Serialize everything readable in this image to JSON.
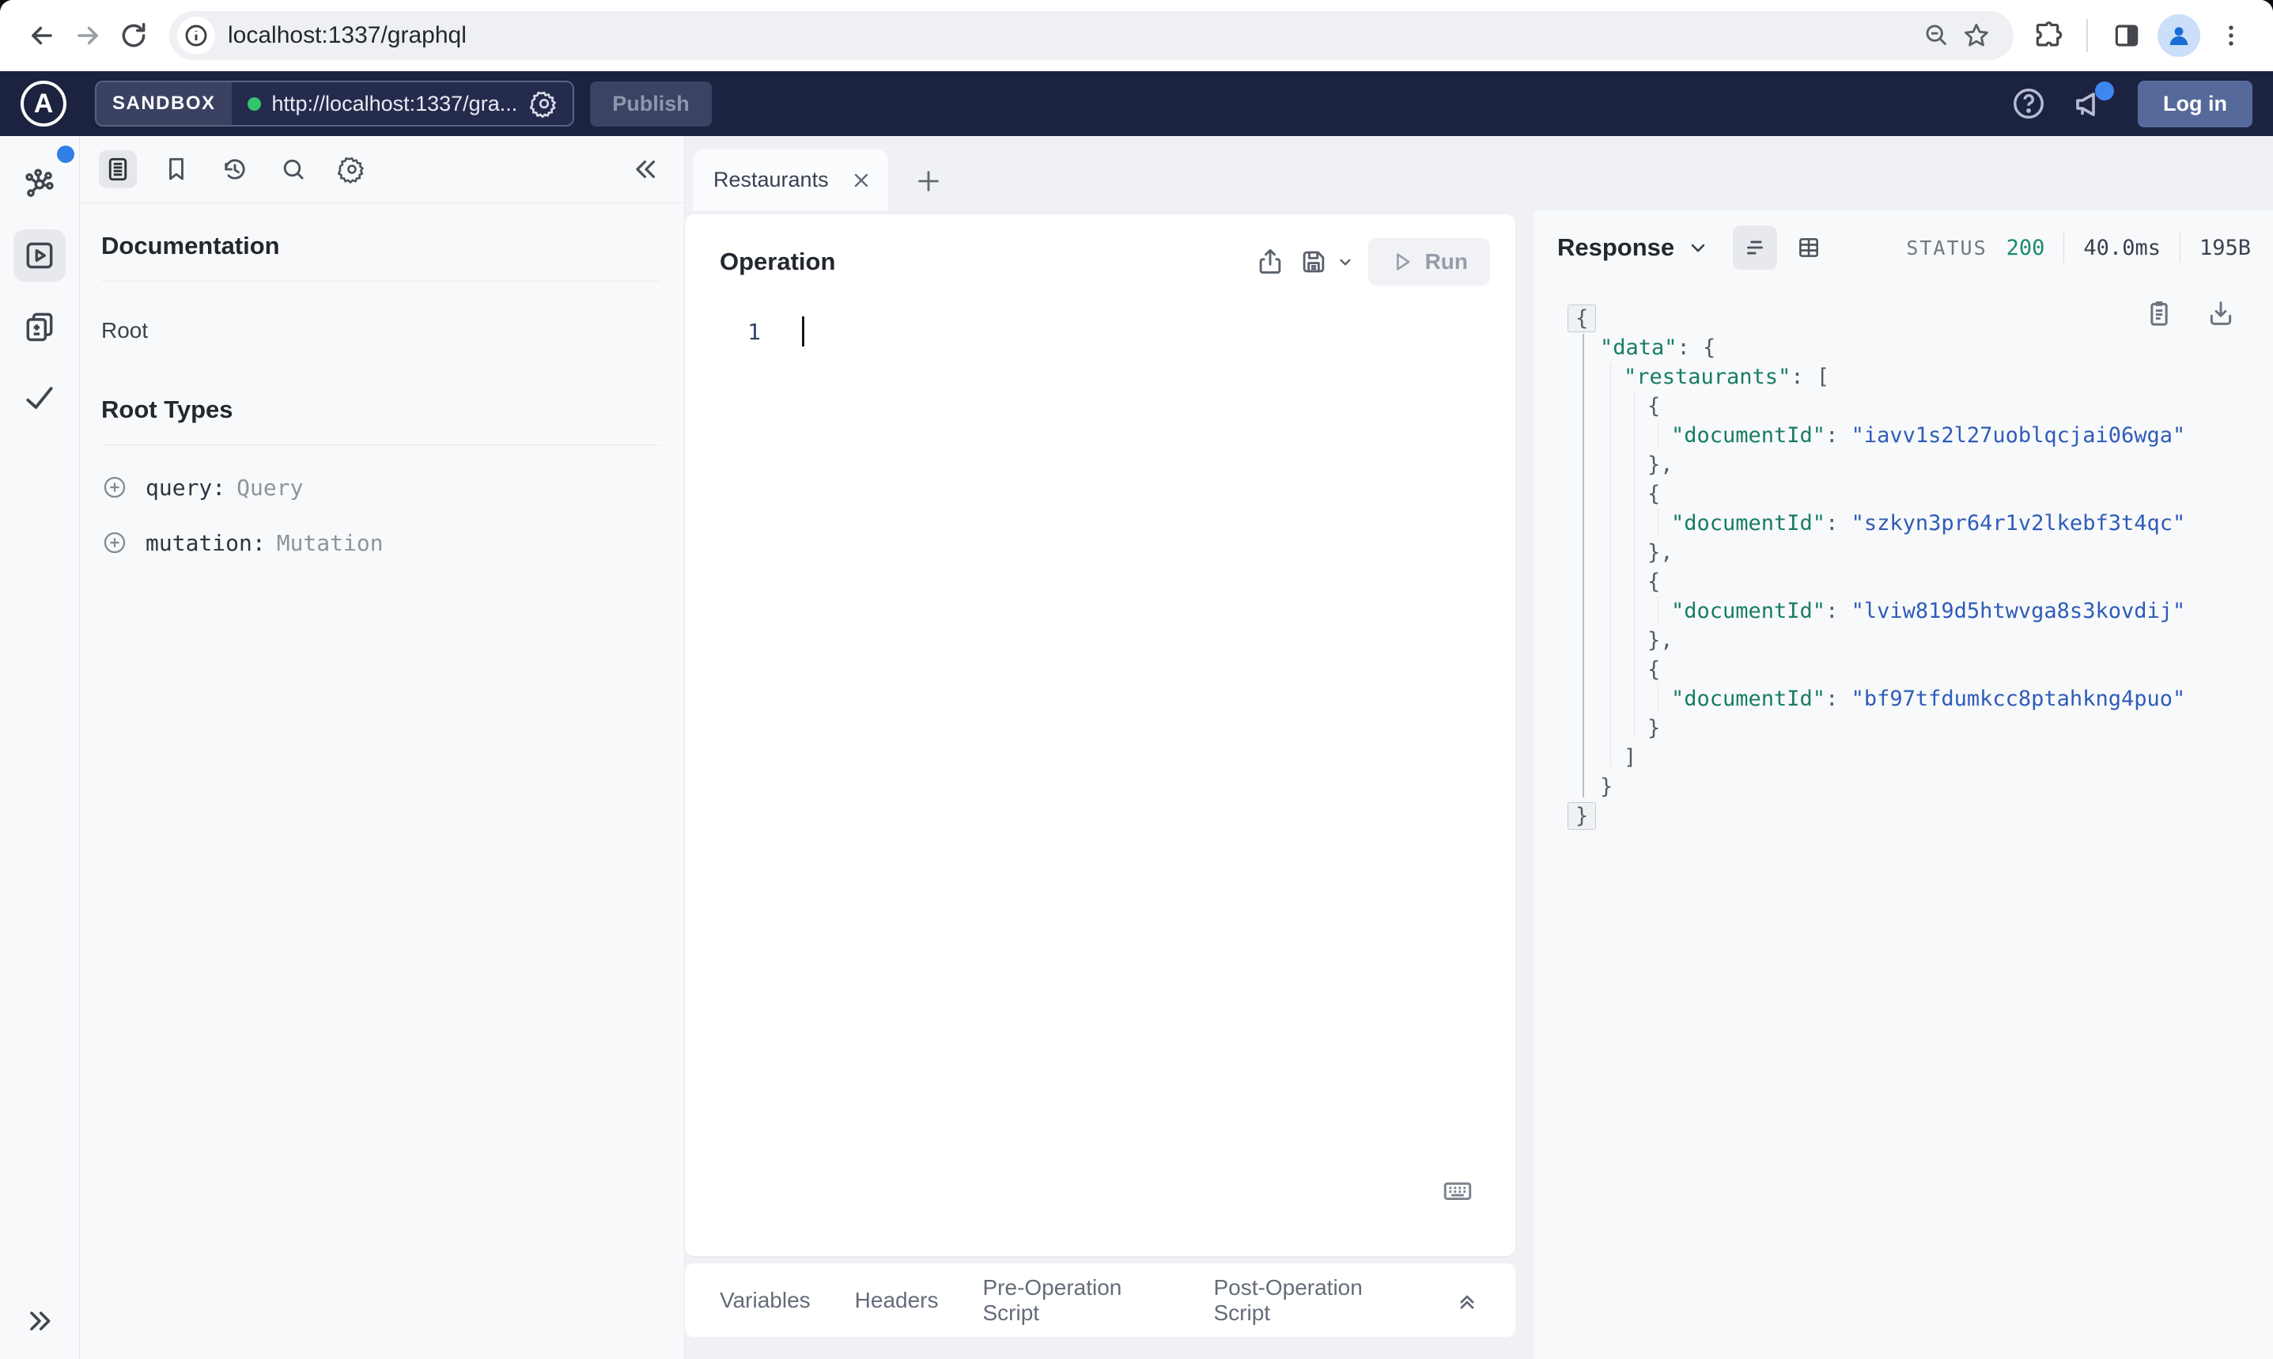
{
  "browser": {
    "url": "localhost:1337/graphql"
  },
  "header": {
    "brand_letter": "A",
    "env_label": "SANDBOX",
    "endpoint": "http://localhost:1337/gra...",
    "publish_label": "Publish",
    "login_label": "Log in"
  },
  "docs": {
    "title": "Documentation",
    "root_item": "Root",
    "section_title": "Root Types",
    "root_types": [
      {
        "field": "query:",
        "type": "Query"
      },
      {
        "field": "mutation:",
        "type": "Mutation"
      }
    ]
  },
  "tabs": {
    "active_label": "Restaurants"
  },
  "operation": {
    "title": "Operation",
    "run_label": "Run",
    "line_number": "1",
    "footer_tabs": [
      "Variables",
      "Headers",
      "Pre-Operation Script",
      "Post-Operation Script"
    ]
  },
  "response": {
    "title": "Response",
    "status_label": "STATUS",
    "status_code": "200",
    "status_color": "#1b8a6e",
    "duration": "40.0ms",
    "size": "195B",
    "document_ids": [
      "iavv1s2l27uoblqcjai06wga",
      "szkyn3pr64r1v2lkebf3t4qc",
      "lviw819d5htwvga8s3kovdij",
      "bf97tfdumkcc8ptahkng4puo"
    ],
    "json_lines": [
      {
        "indent": 0,
        "fold": true,
        "tokens": [
          {
            "c": "p",
            "t": "{"
          }
        ]
      },
      {
        "indent": 1,
        "tokens": [
          {
            "c": "k",
            "t": "\"data\""
          },
          {
            "c": "p",
            "t": ": {"
          }
        ]
      },
      {
        "indent": 2,
        "tokens": [
          {
            "c": "k",
            "t": "\"restaurants\""
          },
          {
            "c": "p",
            "t": ": ["
          }
        ]
      },
      {
        "indent": 3,
        "tokens": [
          {
            "c": "p",
            "t": "{"
          }
        ]
      },
      {
        "indent": 4,
        "tokens": [
          {
            "c": "k",
            "t": "\"documentId\""
          },
          {
            "c": "p",
            "t": ": "
          },
          {
            "c": "s",
            "t": "\"iavv1s2l27uoblqcjai06wga\""
          }
        ]
      },
      {
        "indent": 3,
        "tokens": [
          {
            "c": "p",
            "t": "},"
          }
        ]
      },
      {
        "indent": 3,
        "tokens": [
          {
            "c": "p",
            "t": "{"
          }
        ]
      },
      {
        "indent": 4,
        "tokens": [
          {
            "c": "k",
            "t": "\"documentId\""
          },
          {
            "c": "p",
            "t": ": "
          },
          {
            "c": "s",
            "t": "\"szkyn3pr64r1v2lkebf3t4qc\""
          }
        ]
      },
      {
        "indent": 3,
        "tokens": [
          {
            "c": "p",
            "t": "},"
          }
        ]
      },
      {
        "indent": 3,
        "tokens": [
          {
            "c": "p",
            "t": "{"
          }
        ]
      },
      {
        "indent": 4,
        "tokens": [
          {
            "c": "k",
            "t": "\"documentId\""
          },
          {
            "c": "p",
            "t": ": "
          },
          {
            "c": "s",
            "t": "\"lviw819d5htwvga8s3kovdij\""
          }
        ]
      },
      {
        "indent": 3,
        "tokens": [
          {
            "c": "p",
            "t": "},"
          }
        ]
      },
      {
        "indent": 3,
        "tokens": [
          {
            "c": "p",
            "t": "{"
          }
        ]
      },
      {
        "indent": 4,
        "tokens": [
          {
            "c": "k",
            "t": "\"documentId\""
          },
          {
            "c": "p",
            "t": ": "
          },
          {
            "c": "s",
            "t": "\"bf97tfdumkcc8ptahkng4puo\""
          }
        ]
      },
      {
        "indent": 3,
        "tokens": [
          {
            "c": "p",
            "t": "}"
          }
        ]
      },
      {
        "indent": 2,
        "tokens": [
          {
            "c": "p",
            "t": "]"
          }
        ]
      },
      {
        "indent": 1,
        "tokens": [
          {
            "c": "p",
            "t": "}"
          }
        ]
      },
      {
        "indent": 0,
        "fold": true,
        "tokens": [
          {
            "c": "p",
            "t": "}"
          }
        ]
      }
    ]
  },
  "colors": {
    "apollo_header_bg": "#1c2340",
    "accent_green_dot": "#35c46e",
    "notification_blue": "#3f86f0",
    "json_key": "#177c66",
    "json_string": "#2e5cb8"
  }
}
